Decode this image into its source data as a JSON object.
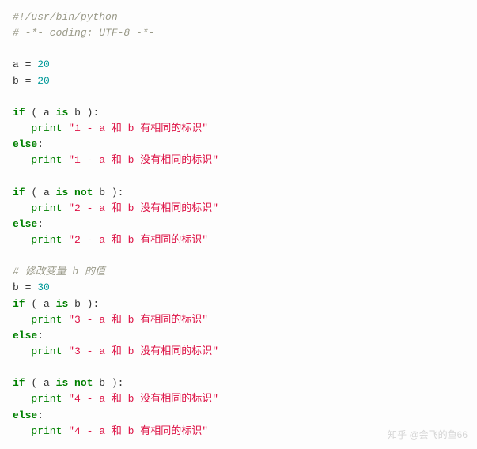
{
  "code": {
    "shebang": "#!/usr/bin/python",
    "coding": "# -*- coding: UTF-8 -*-",
    "assign1_var": "a",
    "assign1_val": "20",
    "assign2_var": "b",
    "assign2_val": "20",
    "kw_if": "if",
    "kw_else": "else",
    "kw_is": "is",
    "kw_is_not": "is not",
    "kw_print": "print",
    "cond1": "( a is b ):",
    "cond2": "( a is not b ):",
    "str1a": "\"1 - a 和 b 有相同的标识\"",
    "str1b": "\"1 - a 和 b 没有相同的标识\"",
    "str2a": "\"2 - a 和 b 没有相同的标识\"",
    "str2b": "\"2 - a 和 b 有相同的标识\"",
    "comment_modify": "# 修改变量 b 的值",
    "assign3_var": "b",
    "assign3_val": "30",
    "str3a": "\"3 - a 和 b 有相同的标识\"",
    "str3b": "\"3 - a 和 b 没有相同的标识\"",
    "str4a": "\"4 - a 和 b 没有相同的标识\"",
    "str4b": "\"4 - a 和 b 有相同的标识\""
  },
  "watermark": "知乎 @会飞的鱼66"
}
